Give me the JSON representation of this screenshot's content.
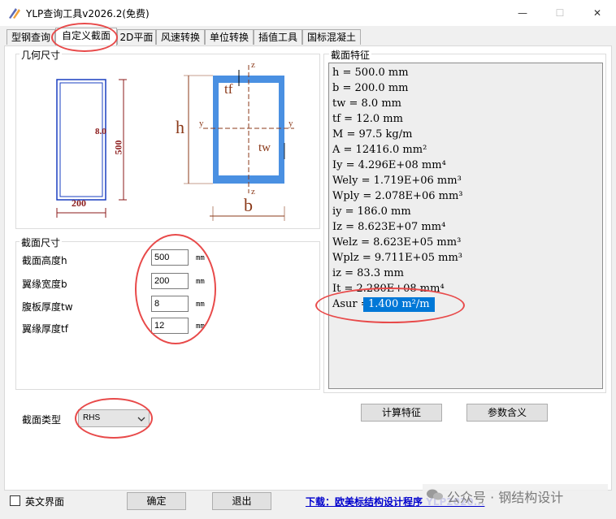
{
  "window": {
    "title": "YLP查询工具v2026.2(免费)",
    "minimize_glyph": "—",
    "maximize_glyph": "☐",
    "close_glyph": "✕"
  },
  "tabs": [
    {
      "label": "型钢查询"
    },
    {
      "label": "自定义截面"
    },
    {
      "label": "2D平面"
    },
    {
      "label": "风速转换"
    },
    {
      "label": "单位转换"
    },
    {
      "label": "插值工具"
    },
    {
      "label": "国标混凝土"
    }
  ],
  "geometry": {
    "group_label": "几何尺寸",
    "preview": {
      "width_label": "200",
      "height_label": "500",
      "thickness_label": "8.0"
    },
    "diagram": {
      "h": "h",
      "b": "b",
      "tf": "tf",
      "tw": "tw",
      "y_left": "y",
      "y_right": "y",
      "z_top": "z",
      "z_bottom": "z"
    }
  },
  "dimensions": {
    "group_label": "截面尺寸",
    "fields": [
      {
        "label": "截面高度h",
        "value": "500",
        "unit": "mm"
      },
      {
        "label": "翼缘宽度b",
        "value": "200",
        "unit": "mm"
      },
      {
        "label": "腹板厚度tw",
        "value": "8",
        "unit": "mm"
      },
      {
        "label": "翼缘厚度tf",
        "value": "12",
        "unit": "mm"
      }
    ]
  },
  "section_type": {
    "label": "截面类型",
    "value": "RHS"
  },
  "properties": {
    "group_label": "截面特征",
    "lines": [
      "h = 500.0 mm",
      "b = 200.0 mm",
      "tw = 8.0 mm",
      "tf = 12.0 mm",
      "M = 97.5 kg/m",
      "A = 12416.0 mm²",
      "Iy = 4.296E+08 mm⁴",
      "Wely = 1.719E+06 mm³",
      "Wply = 2.078E+06 mm³",
      "iy = 186.0 mm",
      "Iz = 8.623E+07 mm⁴",
      "Welz = 8.623E+05 mm³",
      "Wplz = 9.711E+05 mm³",
      "iz = 83.3 mm",
      "It = 2.280E+08 mm⁴"
    ],
    "selected_label": "Asur =",
    "selected_value": "1.400 m²/m"
  },
  "buttons": {
    "calculate": "计算特征",
    "param_meaning": "参数含义"
  },
  "footer": {
    "english_ui": "英文界面",
    "ok": "确定",
    "exit": "退出",
    "download_link": "下载：欧美标结构设计程序 YLP2020...",
    "watermark": "公众号 · 钢结构设计"
  },
  "colors": {
    "highlight": "#e84a4a",
    "section_fill": "#4a90e2",
    "selection": "#0078d7",
    "dim_lines": "#8b3a1a",
    "link": "#0000cc"
  }
}
